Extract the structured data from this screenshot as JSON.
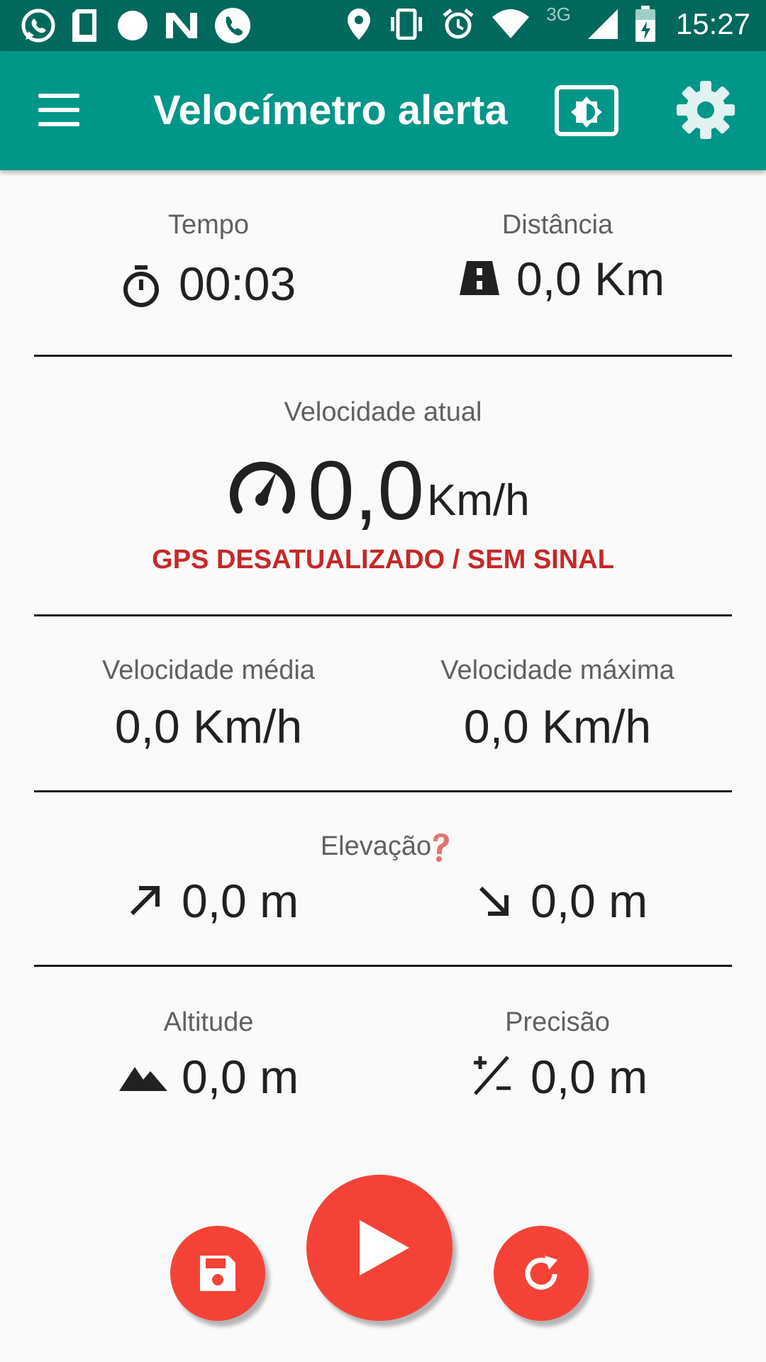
{
  "status_bar": {
    "time": "15:27",
    "network": "3G",
    "icons": [
      "whatsapp-icon",
      "sd-card-icon",
      "circle-icon",
      "n-icon",
      "phone-icon",
      "location-icon",
      "vibrate-icon",
      "alarm-icon",
      "wifi-icon",
      "signal-icon",
      "battery-icon"
    ]
  },
  "app_bar": {
    "title": "Velocímetro alerta",
    "icons": [
      "menu-icon",
      "brightness-icon",
      "settings-gear-icon"
    ],
    "color": "#009688"
  },
  "stats": {
    "time": {
      "label": "Tempo",
      "value": "00:03"
    },
    "distance": {
      "label": "Distância",
      "value": "0,0 Km"
    },
    "current_speed": {
      "label": "Velocidade atual",
      "value": "0,0",
      "unit": "Km/h",
      "warning": "GPS DESATUALIZADO / SEM SINAL"
    },
    "avg_speed": {
      "label": "Velocidade média",
      "value": "0,0 Km/h"
    },
    "max_speed": {
      "label": "Velocidade máxima",
      "value": "0,0 Km/h"
    },
    "elevation": {
      "label": "Elevação",
      "up": "0,0 m",
      "down": "0,0 m"
    },
    "altitude": {
      "label": "Altitude",
      "value": "0,0 m"
    },
    "precision": {
      "label": "Precisão",
      "value": "0,0 m"
    }
  },
  "colors": {
    "accent": "#f44336",
    "warning": "#c62828",
    "status_bar": "#00695c"
  }
}
